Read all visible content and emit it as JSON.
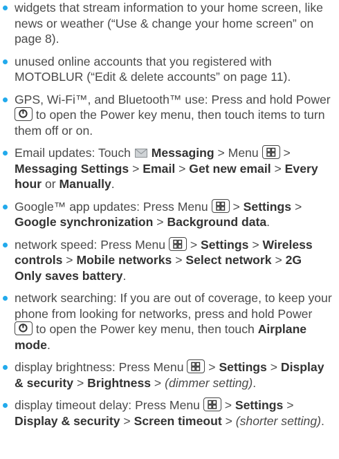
{
  "accent_color": "#22aaec",
  "icons": [
    "power-key-icon",
    "menu-key-icon",
    "envelope-icon"
  ],
  "items": [
    {
      "t": [
        "widgets that stream information to your home screen, like news or weather (“Use & change your home screen” on page 8)."
      ]
    },
    {
      "t": [
        "unused online accounts that you registered with MOTOBLUR (“Edit & delete accounts” on page 11)."
      ]
    },
    {
      "t": [
        "GPS, Wi-Fi™, and Bluetooth™ use: Press and hold Power ",
        " to open the Power key menu, then touch items to turn them off or on."
      ]
    },
    {
      "t": [
        "Email updates: Touch ",
        " ",
        "Messaging",
        " > Menu ",
        " > ",
        "Messaging Settings",
        " > ",
        "Email",
        " > ",
        "Get new email",
        " > ",
        "Every hour",
        " or ",
        "Manually",
        "."
      ]
    },
    {
      "t": [
        "Google™ app updates: Press Menu ",
        " > ",
        "Settings",
        " > ",
        "Google synchronization",
        " > ",
        "Background data",
        "."
      ]
    },
    {
      "t": [
        "network speed: Press Menu ",
        " > ",
        "Settings",
        " > ",
        "Wireless controls",
        " > ",
        "Mobile networks",
        " > ",
        "Select network",
        " > ",
        "2G Only saves battery",
        "."
      ]
    },
    {
      "t": [
        "network searching: If you are out of coverage, to keep your phone from looking for networks, press and hold Power ",
        " to open the Power key menu, then touch ",
        "Airplane mode",
        "."
      ]
    },
    {
      "t": [
        "display brightness: Press Menu ",
        " > ",
        "Settings",
        " > ",
        "Display & security",
        " > ",
        "Brightness",
        " > ",
        "(dimmer setting)",
        "."
      ]
    },
    {
      "t": [
        "display timeout delay: Press Menu ",
        " > ",
        "Settings",
        " > ",
        "Display & security",
        " > ",
        "Screen timeout",
        " > ",
        "(shorter setting)",
        "."
      ]
    }
  ]
}
